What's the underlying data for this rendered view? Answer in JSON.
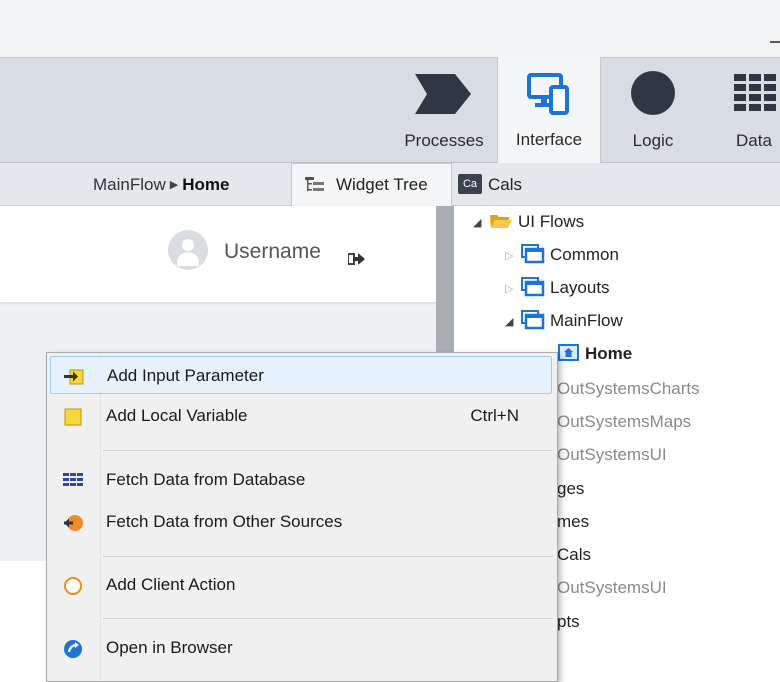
{
  "toolbar": {
    "tools": [
      {
        "label": "Processes",
        "icon": "chevron-arrow-icon"
      },
      {
        "label": "Interface",
        "icon": "monitor-phone-icon",
        "active": true
      },
      {
        "label": "Logic",
        "icon": "circle-icon"
      },
      {
        "label": "Data",
        "icon": "grid-icon"
      }
    ]
  },
  "breadcrumb": {
    "parent": "MainFlow",
    "current": "Home"
  },
  "tabs": {
    "widget_tree": "Widget Tree",
    "module_badge": "Ca",
    "module_name": "Cals"
  },
  "canvas": {
    "username": "Username"
  },
  "tree": {
    "ui_flows": "UI Flows",
    "common": "Common",
    "layouts": "Layouts",
    "mainflow": "MainFlow",
    "home": "Home",
    "rows": [
      "OutSystemsCharts",
      "OutSystemsMaps",
      "OutSystemsUI",
      "ges",
      "mes",
      "Cals",
      "OutSystemsUI",
      "pts"
    ]
  },
  "menu": {
    "items": [
      {
        "label": "Add Input Parameter",
        "shortcut": "",
        "icon": "input-parameter-icon"
      },
      {
        "label": "Add Local Variable",
        "shortcut": "Ctrl+N",
        "icon": "local-variable-icon"
      },
      {
        "label": "Fetch Data from Database",
        "shortcut": "",
        "icon": "database-grid-icon"
      },
      {
        "label": "Fetch Data from Other Sources",
        "shortcut": "",
        "icon": "external-source-icon"
      },
      {
        "label": "Add Client Action",
        "shortcut": "",
        "icon": "client-action-icon"
      },
      {
        "label": "Open in Browser",
        "shortcut": "",
        "icon": "browser-icon"
      }
    ]
  },
  "colors": {
    "accent": "#1e73d6",
    "highlight": "#e5f1fb",
    "toolbar_bg": "#d7dde2",
    "folder": "#f2b824"
  }
}
